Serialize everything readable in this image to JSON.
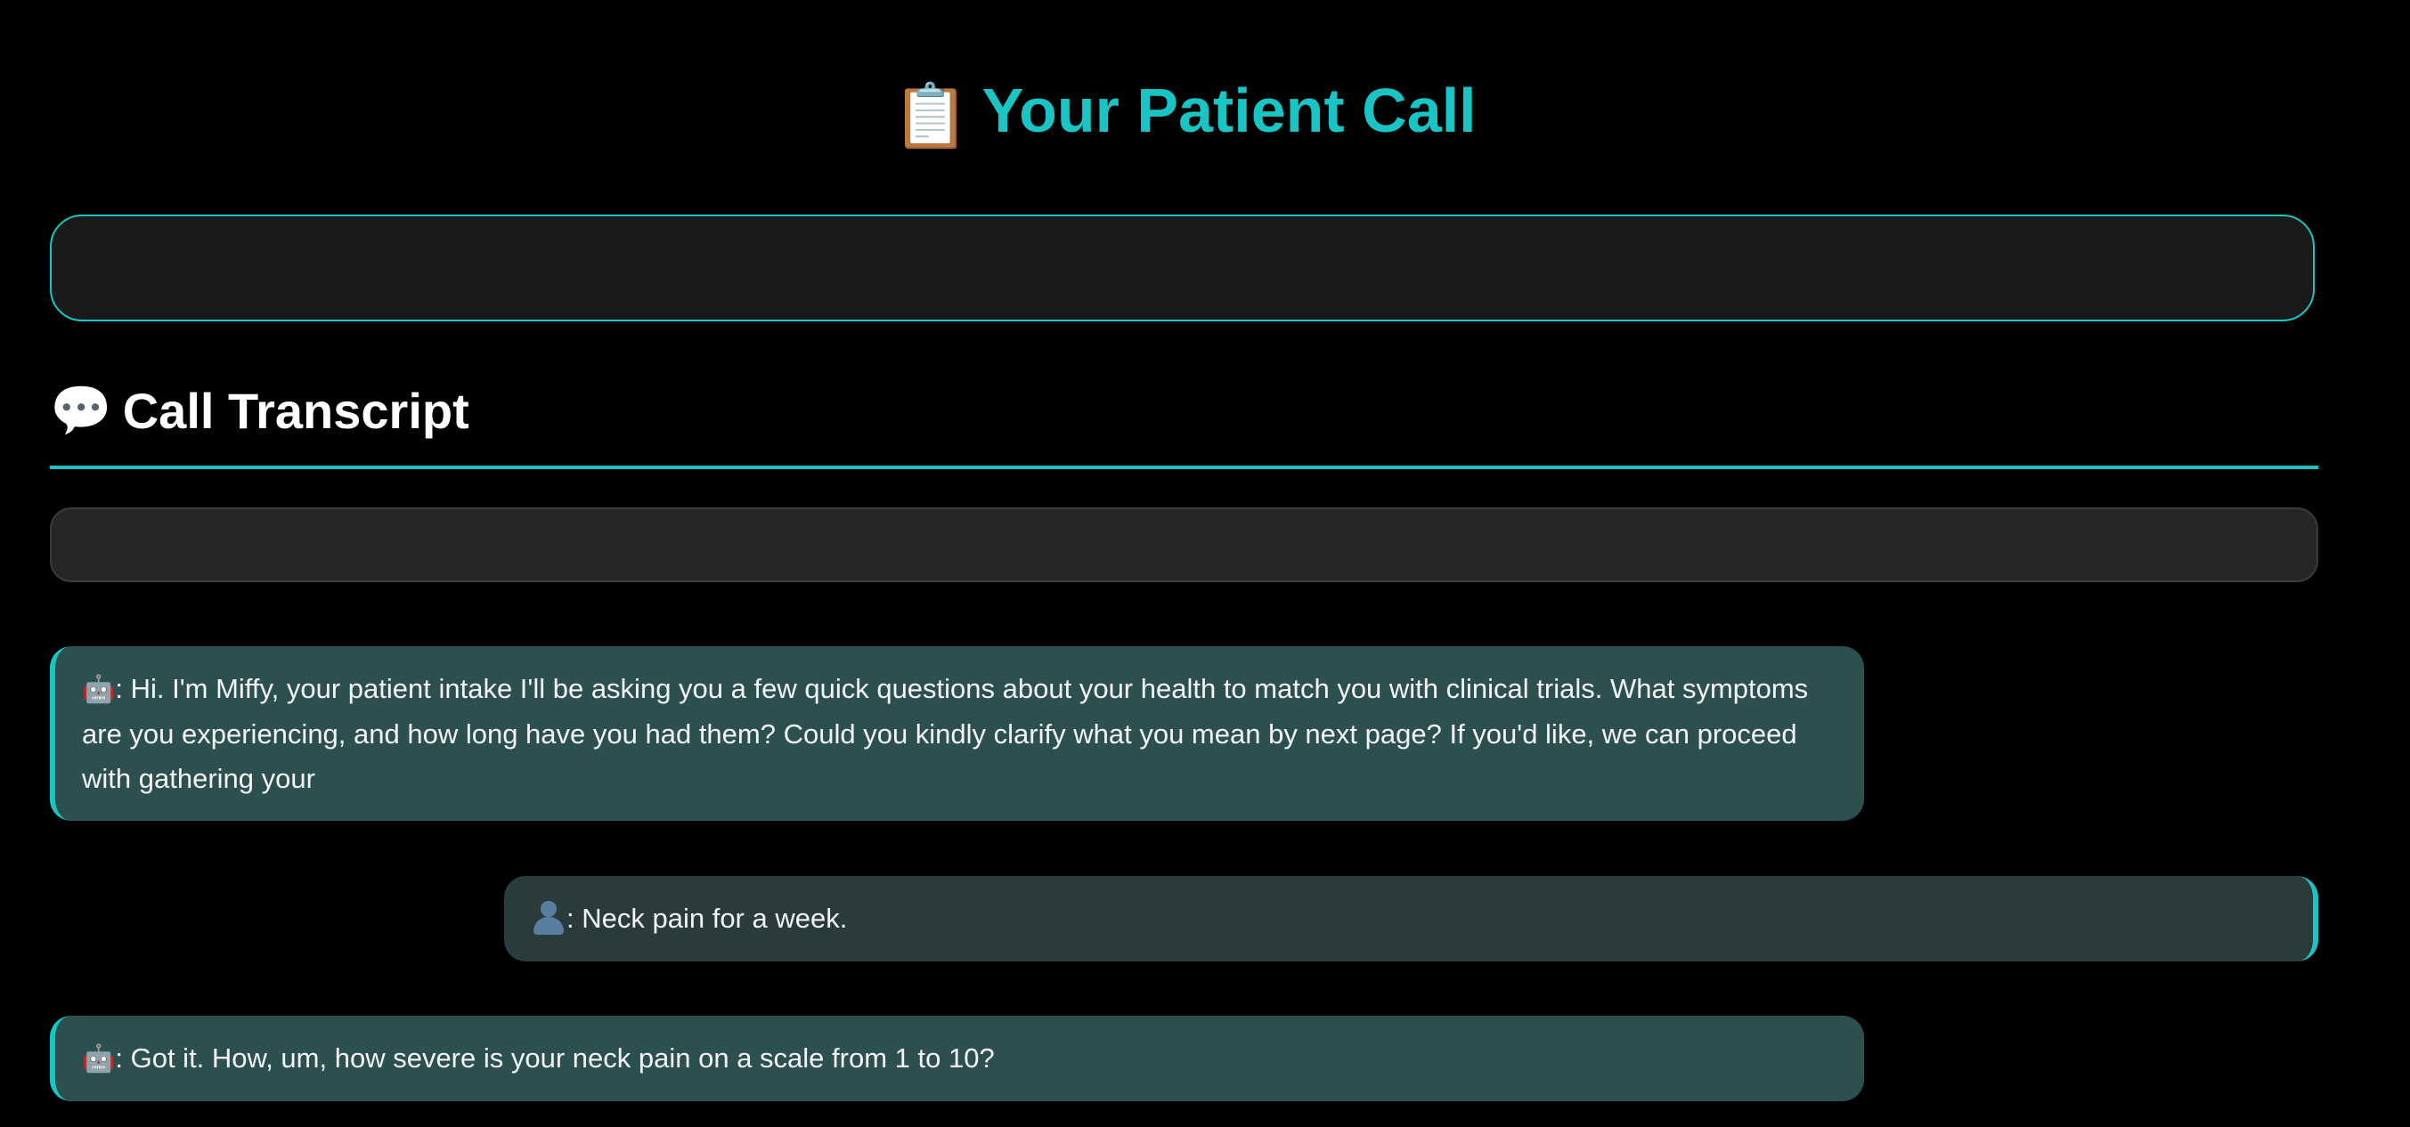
{
  "header": {
    "emoji": "📋",
    "title": "Your Patient Call"
  },
  "transcript": {
    "emoji": "💬",
    "heading": "Call Transcript",
    "accent_color": "#18c4c4"
  },
  "messages": [
    {
      "speaker": "bot",
      "icon": "🤖",
      "separator": ":",
      "text": " Hi. I'm Miffy, your patient intake I'll be asking you a few quick questions about your health to match you with clinical trials. What symptoms are you experiencing, and how long have you had them? Could you kindly clarify what you mean by next page? If you'd like, we can proceed with gathering your"
    },
    {
      "speaker": "user",
      "icon": "user-icon",
      "separator": ":",
      "text": " Neck pain for a week."
    },
    {
      "speaker": "bot",
      "icon": "🤖",
      "separator": ":",
      "text": " Got it. How, um, how severe is your neck pain on a scale from 1 to 10?"
    }
  ],
  "colors": {
    "background": "#000000",
    "accent": "#18c4c4",
    "bot_bubble": "#2c5050",
    "user_bubble": "#293b3b"
  }
}
